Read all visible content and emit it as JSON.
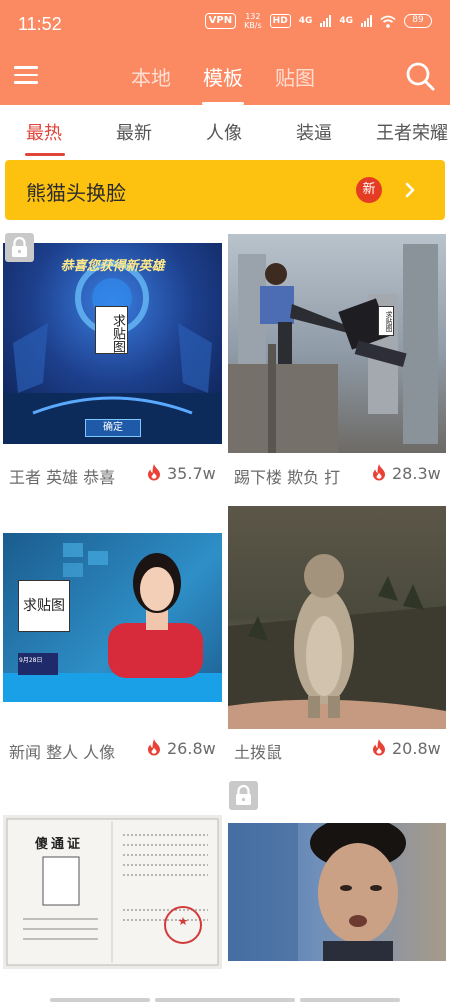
{
  "status": {
    "time": "11:52",
    "vpn": "VPN",
    "speed_value": "132",
    "speed_unit": "KB/s",
    "hd": "HD",
    "network1": "4G",
    "network2": "4G",
    "battery": "89"
  },
  "top_tabs": [
    "本地",
    "模板",
    "贴图"
  ],
  "active_top_tab": "模板",
  "categories": [
    "最热",
    "最新",
    "人像",
    "装逼",
    "王者荣耀"
  ],
  "active_category": "最热",
  "banner": {
    "title": "熊猫头换脸",
    "badge": "新"
  },
  "cards": [
    {
      "caption": "王者 英雄 恭喜",
      "count": "35.7w",
      "image_text": "恭喜您获得新英雄",
      "sticker": "求贴图",
      "button": "确定",
      "locked": true
    },
    {
      "caption": "踢下楼 欺负 打",
      "count": "28.3w",
      "sticker": "求贴图",
      "locked": false
    },
    {
      "caption": "新闻 整人 人像",
      "count": "26.8w",
      "sticker": "求贴图",
      "date": "9月28日",
      "locked": false
    },
    {
      "caption": "土拨鼠",
      "count": "20.8w",
      "locked": false
    },
    {
      "image_text": "傻通证",
      "locked": false
    },
    {
      "locked": true
    }
  ],
  "colors": {
    "brand": "#fb8a63",
    "accent": "#e0443a",
    "banner": "#fcc20f",
    "badge": "#e53d23"
  },
  "icons": {
    "menu": "menu-icon",
    "search": "search-icon",
    "chevron": "chevron-right-icon",
    "fire": "fire-icon",
    "lock": "lock-icon"
  }
}
